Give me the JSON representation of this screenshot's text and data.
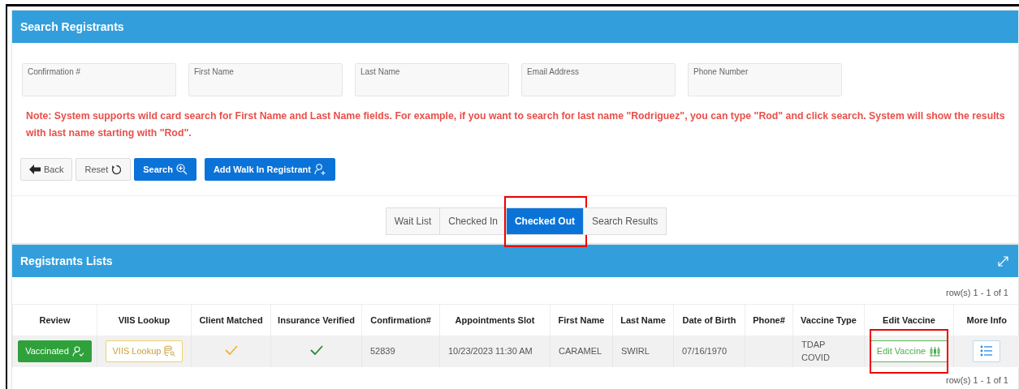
{
  "search_panel": {
    "title": "Search Registrants",
    "fields": [
      {
        "placeholder": "Confirmation #"
      },
      {
        "placeholder": "First Name"
      },
      {
        "placeholder": "Last Name"
      },
      {
        "placeholder": "Email Address"
      },
      {
        "placeholder": "Phone Number"
      }
    ],
    "note": "Note: System supports wild card search for First Name and Last Name fields. For example, if you want to search for last name \"Rodriguez\", you can type \"Rod\" and click search. System will show the results with last name starting with \"Rod\".",
    "buttons": [
      {
        "label": "Back",
        "kind": "back"
      },
      {
        "label": "Reset",
        "kind": "reset"
      },
      {
        "label": "Search",
        "kind": "search"
      },
      {
        "label": "Add Walk In Registrant",
        "kind": "add"
      }
    ]
  },
  "tabs": [
    {
      "label": "Wait List",
      "selected": false,
      "highlighted": false
    },
    {
      "label": "Checked In",
      "selected": false,
      "highlighted": false
    },
    {
      "label": "Checked Out",
      "selected": true,
      "highlighted": true
    },
    {
      "label": "Search Results",
      "selected": false,
      "highlighted": false
    }
  ],
  "list_panel": {
    "title": "Registrants Lists",
    "row_count_top": "row(s) 1 - 1 of 1",
    "row_count_bottom": "row(s) 1 - 1 of 1",
    "columns": [
      "Review",
      "VIIS Lookup",
      "Client Matched",
      "Insurance Verified",
      "Confirmation#",
      "Appointments Slot",
      "First Name",
      "Last Name",
      "Date of Birth",
      "Phone#",
      "Vaccine Type",
      "Edit Vaccine",
      "More Info"
    ],
    "rows": [
      {
        "review": "Vaccinated",
        "viis_lookup": "VIIS Lookup",
        "client_matched": true,
        "insurance_verified": true,
        "confirmation": "52839",
        "slot": "10/23/2023 11:30 AM",
        "first_name": "CARAMEL",
        "last_name": "SWIRL",
        "date_of_birth": "07/16/1970",
        "vaccine_type": [
          "TDAP",
          "COVID"
        ],
        "edit_vaccine": "Edit Vaccine",
        "edit_highlighted": true
      }
    ]
  }
}
